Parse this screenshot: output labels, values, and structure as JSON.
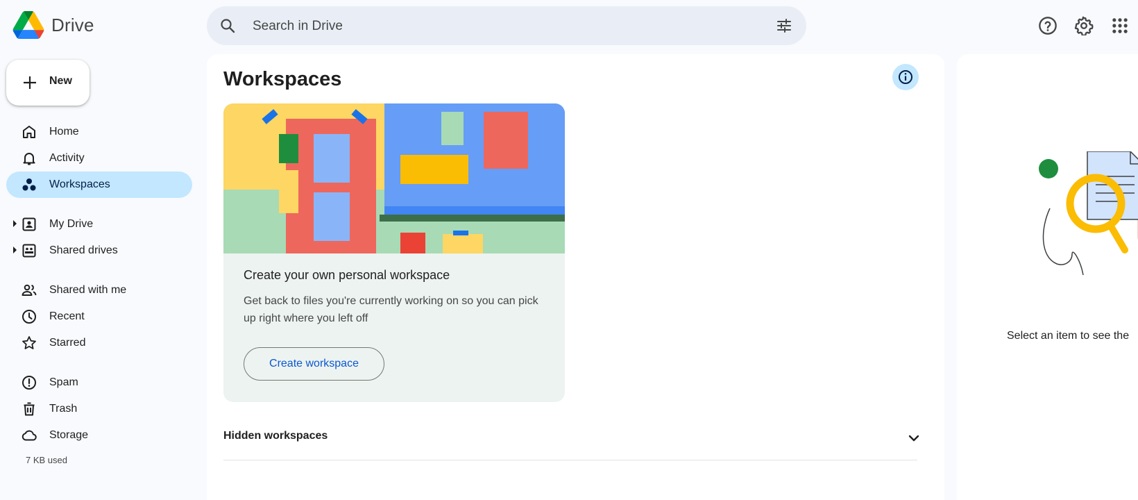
{
  "app": {
    "name": "Drive"
  },
  "search": {
    "placeholder": "Search in Drive"
  },
  "top_icons": [
    "help-icon",
    "settings-icon",
    "apps-grid-icon"
  ],
  "sidebar": {
    "new_label": "New",
    "items": [
      {
        "label": "Home",
        "icon": "home-icon"
      },
      {
        "label": "Activity",
        "icon": "bell-icon"
      },
      {
        "label": "Workspaces",
        "icon": "workspaces-icon",
        "active": true
      },
      {
        "label": "My Drive",
        "icon": "my-drive-icon",
        "expandable": true
      },
      {
        "label": "Shared drives",
        "icon": "shared-drives-icon",
        "expandable": true
      },
      {
        "label": "Shared with me",
        "icon": "people-icon"
      },
      {
        "label": "Recent",
        "icon": "clock-icon"
      },
      {
        "label": "Starred",
        "icon": "star-icon"
      },
      {
        "label": "Spam",
        "icon": "spam-icon"
      },
      {
        "label": "Trash",
        "icon": "trash-icon"
      },
      {
        "label": "Storage",
        "icon": "cloud-icon"
      }
    ],
    "storage_used": "7 KB used"
  },
  "main": {
    "title": "Workspaces",
    "card": {
      "title": "Create your own personal workspace",
      "description": "Get back to files you're currently working on so you can pick up right where you left off",
      "button_label": "Create workspace"
    },
    "hidden_workspaces_label": "Hidden workspaces"
  },
  "details": {
    "empty_text": "Select an item to see the"
  },
  "colors": {
    "background": "#f8fafd",
    "active_nav": "#c2e7ff",
    "search_bg": "#e9eef6",
    "link_blue": "#0b57d0",
    "card_bg": "#edf3f0"
  }
}
